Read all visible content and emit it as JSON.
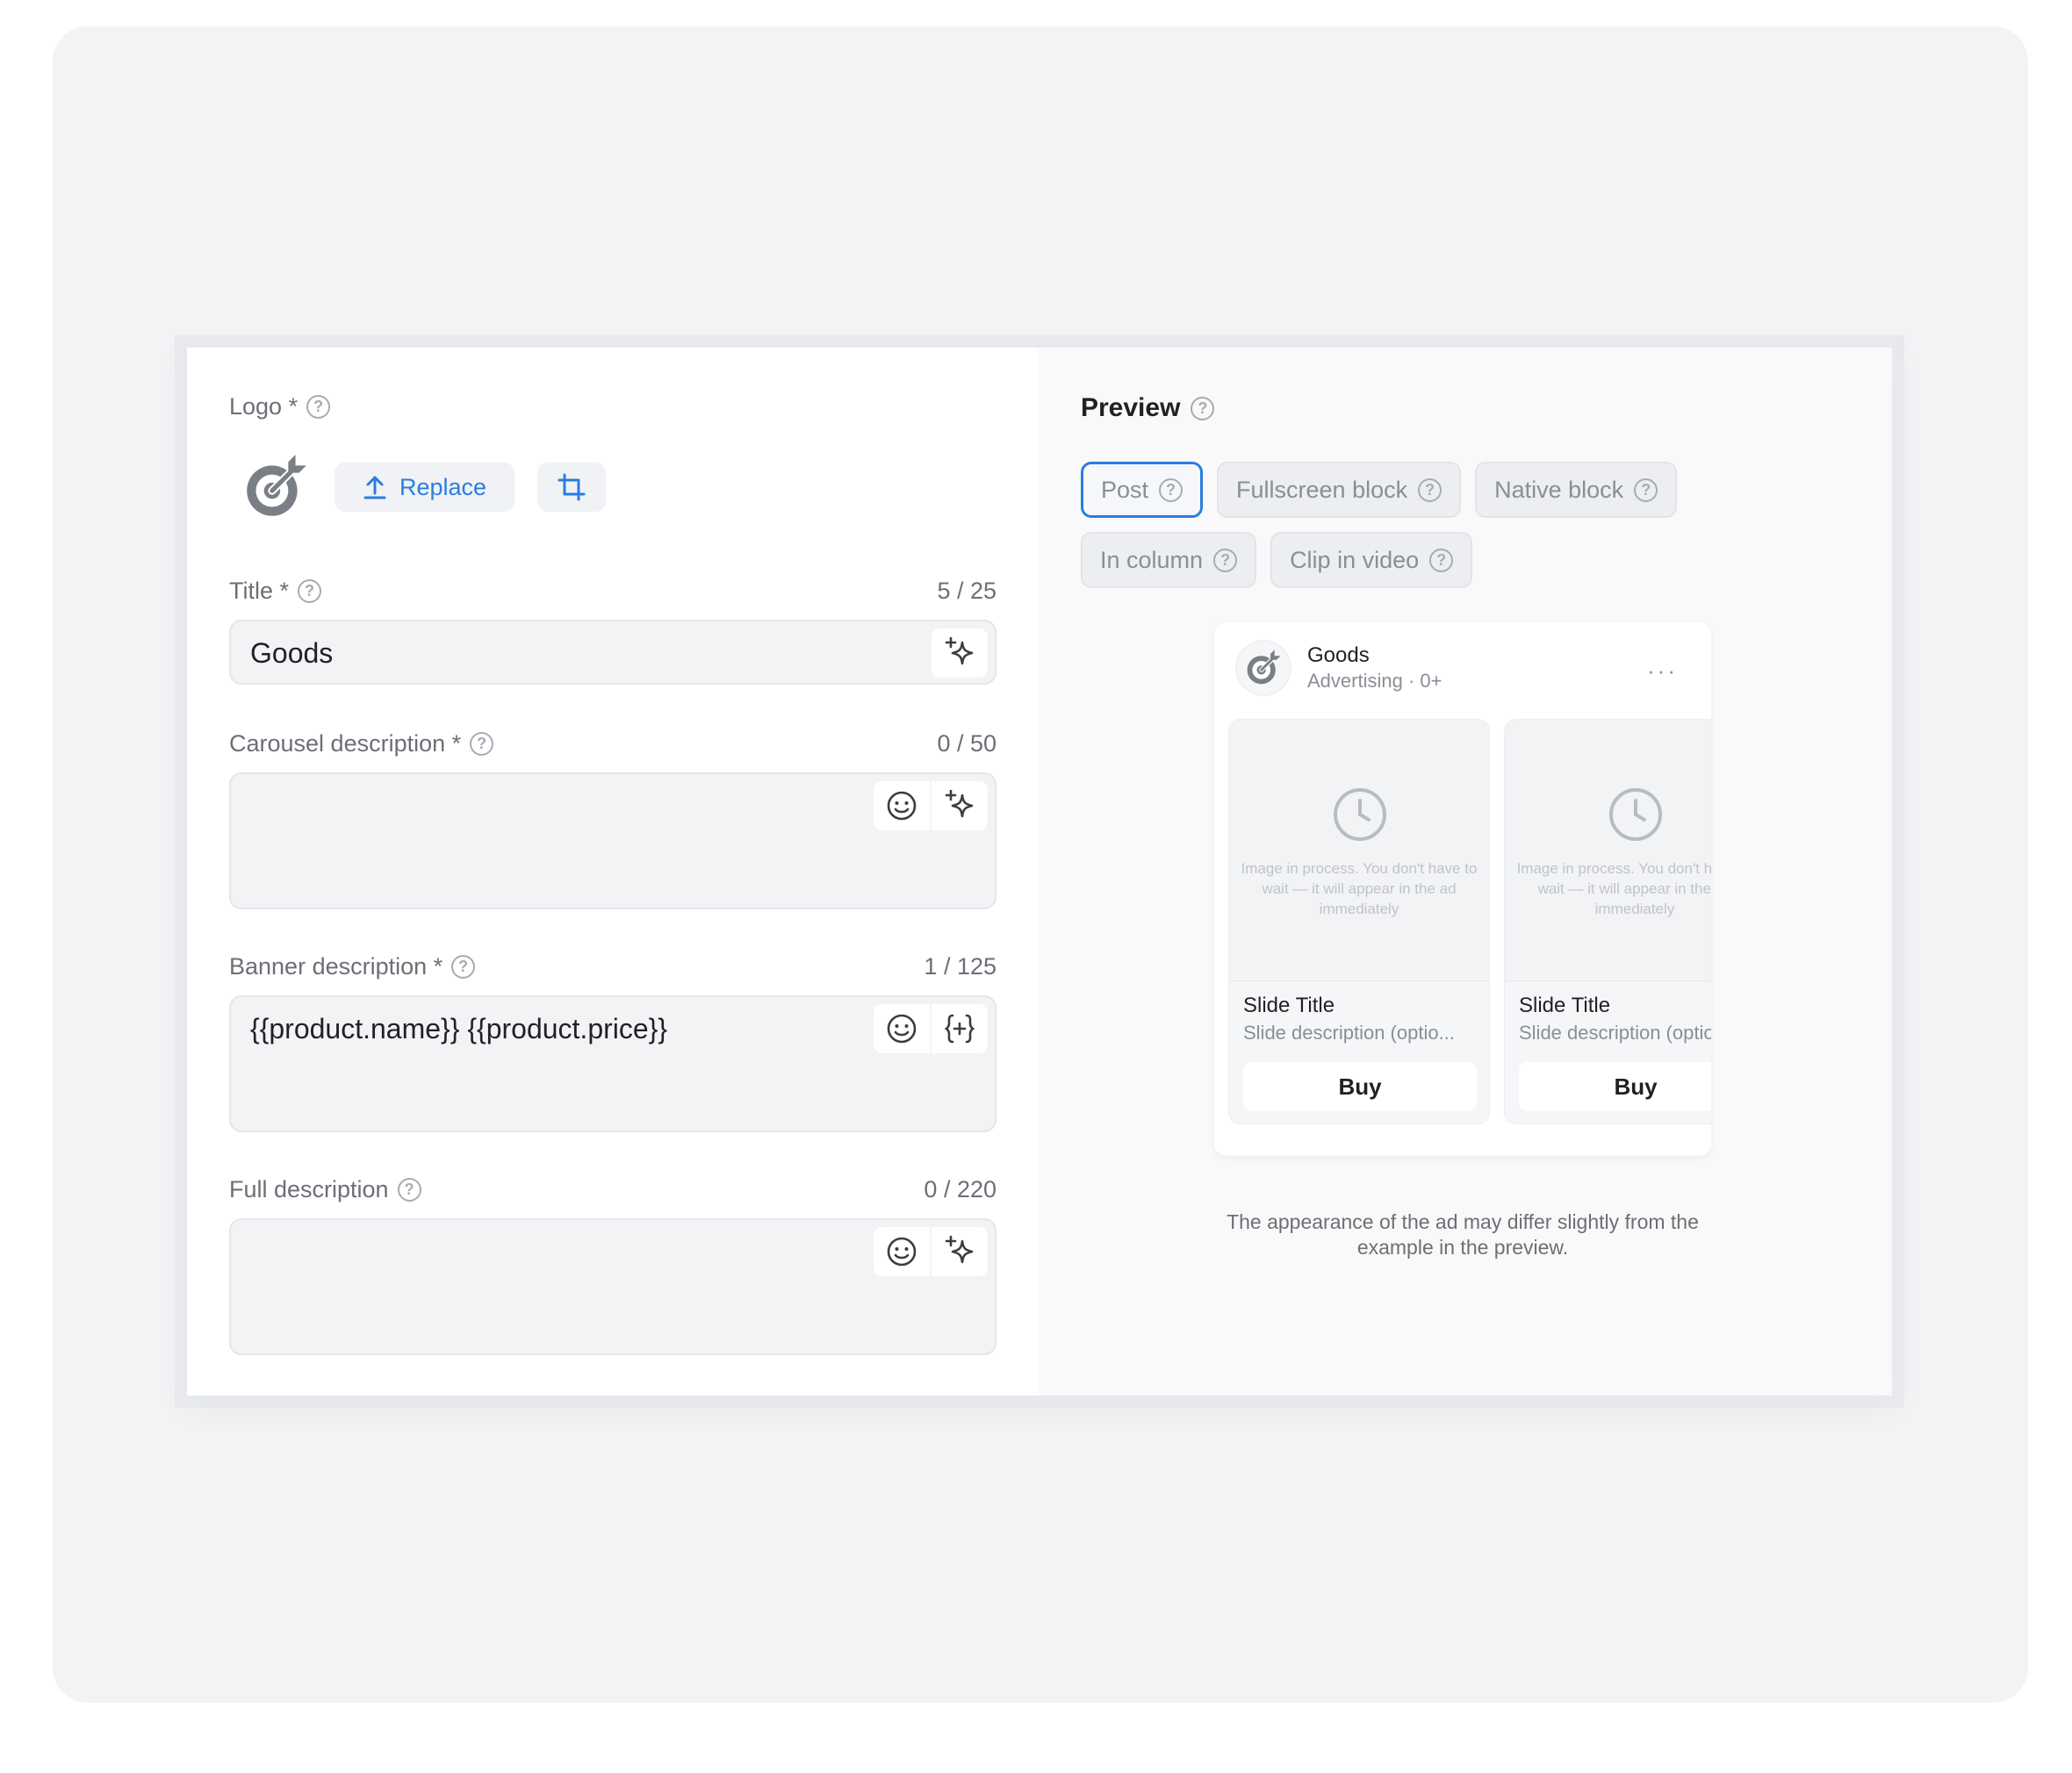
{
  "logo": {
    "label": "Logo *",
    "replace_label": "Replace"
  },
  "fields": {
    "title": {
      "label": "Title *",
      "counter": "5 / 25",
      "value": "Goods"
    },
    "carousel": {
      "label": "Carousel description *",
      "counter": "0 / 50",
      "value": ""
    },
    "banner": {
      "label": "Banner description *",
      "counter": "1 / 125",
      "value": "{{product.name}} {{product.price}}"
    },
    "full": {
      "label": "Full description",
      "counter": "0 / 220",
      "value": ""
    }
  },
  "preview": {
    "title": "Preview",
    "formats": [
      "Post",
      "Fullscreen block",
      "Native block",
      "In column",
      "Clip in video"
    ],
    "active_format": "Post",
    "post": {
      "name": "Goods",
      "subtitle": "Advertising · 0+",
      "more": "···",
      "slides": [
        {
          "note": "Image in process. You don't have to wait — it will appear in the ad immediately",
          "title": "Slide Title",
          "description": "Slide description (optio...",
          "button": "Buy"
        },
        {
          "note": "Image in process. You don't have to wait — it will appear in the ad immediately",
          "title": "Slide Title",
          "description": "Slide description (optional)",
          "button": "Buy"
        }
      ]
    },
    "disclaimer": "The appearance of the ad may differ slightly from the example in the preview."
  },
  "colors": {
    "accent": "#2b7de0",
    "field_bg": "#f2f3f5",
    "text": "#1f2124",
    "muted": "#6b6f76"
  }
}
